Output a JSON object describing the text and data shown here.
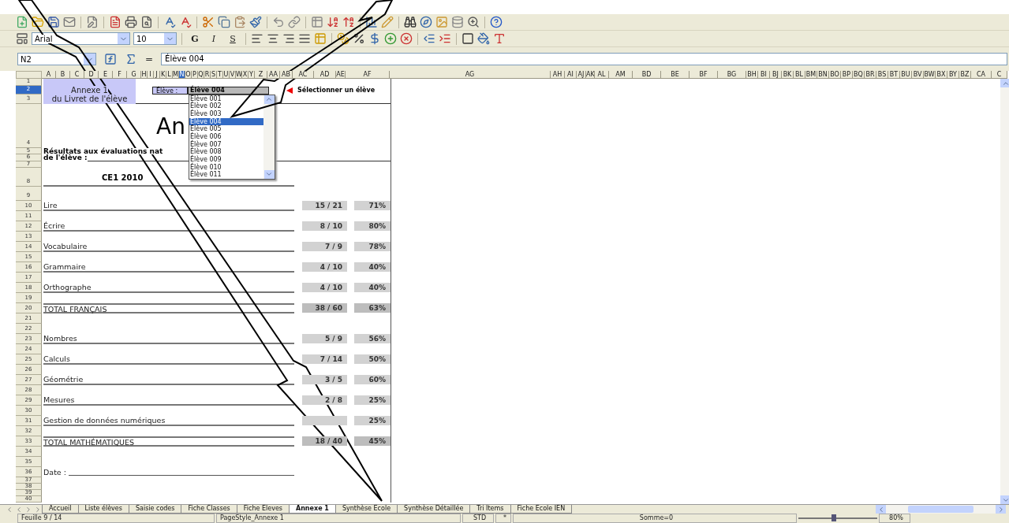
{
  "toolbar": {
    "font_name": "Arial",
    "font_size": "10",
    "format_buttons": [
      {
        "label": "G",
        "selected": false
      },
      {
        "label": "I",
        "selected": false
      },
      {
        "label": "S",
        "selected": false
      }
    ]
  },
  "formula_bar": {
    "cell_ref": "N2",
    "equals": "=",
    "content": "Élève 004"
  },
  "columns": [
    {
      "label": "A",
      "selected": false
    },
    {
      "label": "B",
      "selected": false
    },
    {
      "label": "C",
      "selected": false
    },
    {
      "label": "D",
      "selected": false
    },
    {
      "label": "E",
      "selected": false
    },
    {
      "label": "F",
      "selected": false
    },
    {
      "label": "G",
      "selected": false
    },
    {
      "label": "H",
      "selected": false
    },
    {
      "label": "I",
      "selected": false
    },
    {
      "label": "J",
      "selected": false
    },
    {
      "label": "K",
      "selected": false
    },
    {
      "label": "L",
      "selected": false
    },
    {
      "label": "M",
      "selected": false
    },
    {
      "label": "N",
      "selected": true
    },
    {
      "label": "O",
      "selected": false
    },
    {
      "label": "P",
      "selected": false
    },
    {
      "label": "Q",
      "selected": false
    },
    {
      "label": "R",
      "selected": false
    },
    {
      "label": "S",
      "selected": false
    },
    {
      "label": "T",
      "selected": false
    },
    {
      "label": "U",
      "selected": false
    },
    {
      "label": "V",
      "selected": false
    },
    {
      "label": "W",
      "selected": false
    },
    {
      "label": "X",
      "selected": false
    },
    {
      "label": "Y",
      "selected": false
    },
    {
      "label": "Z",
      "selected": false
    },
    {
      "label": "AA",
      "selected": false
    },
    {
      "label": "AB",
      "selected": false
    },
    {
      "label": "AC",
      "selected": false
    },
    {
      "label": "AD",
      "selected": false
    },
    {
      "label": "AE",
      "selected": false
    },
    {
      "label": "AF",
      "selected": false
    },
    {
      "label": "AG",
      "selected": false
    },
    {
      "label": "AH",
      "selected": false
    },
    {
      "label": "AI",
      "selected": false
    },
    {
      "label": "AJ",
      "selected": false
    },
    {
      "label": "AK",
      "selected": false
    },
    {
      "label": "AL",
      "selected": false
    },
    {
      "label": "AM",
      "selected": false
    },
    {
      "label": "BD",
      "selected": false
    },
    {
      "label": "BE",
      "selected": false
    },
    {
      "label": "BF",
      "selected": false
    },
    {
      "label": "BG",
      "selected": false
    },
    {
      "label": "BH",
      "selected": false
    },
    {
      "label": "BI",
      "selected": false
    },
    {
      "label": "BJ",
      "selected": false
    },
    {
      "label": "BK",
      "selected": false
    },
    {
      "label": "BL",
      "selected": false
    },
    {
      "label": "BM",
      "selected": false
    },
    {
      "label": "BN",
      "selected": false
    },
    {
      "label": "BO",
      "selected": false
    },
    {
      "label": "BP",
      "selected": false
    },
    {
      "label": "BQ",
      "selected": false
    },
    {
      "label": "BR",
      "selected": false
    },
    {
      "label": "BS",
      "selected": false
    },
    {
      "label": "BT",
      "selected": false
    },
    {
      "label": "BU",
      "selected": false
    },
    {
      "label": "BV",
      "selected": false
    },
    {
      "label": "BW",
      "selected": false
    },
    {
      "label": "BX",
      "selected": false
    },
    {
      "label": "BY",
      "selected": false
    },
    {
      "label": "BZ",
      "selected": false
    },
    {
      "label": "CA",
      "selected": false
    },
    {
      "label": "C",
      "selected": false
    }
  ],
  "sheet": {
    "header_block": [
      "Annexe 1",
      "du Livret de l'élève"
    ],
    "picker": {
      "label": "Élève :",
      "value": "Élève 004",
      "expanded": true,
      "options": [
        {
          "label": "Élève 001",
          "selected": false
        },
        {
          "label": "Élève 002",
          "selected": false
        },
        {
          "label": "Élève 003",
          "selected": false
        },
        {
          "label": "Élève 004",
          "selected": true
        },
        {
          "label": "Élève 005",
          "selected": false
        },
        {
          "label": "Élève 006",
          "selected": false
        },
        {
          "label": "Élève 007",
          "selected": false
        },
        {
          "label": "Élève 008",
          "selected": false
        },
        {
          "label": "Élève 009",
          "selected": false
        },
        {
          "label": "Élève 010",
          "selected": false
        },
        {
          "label": "Élève 011",
          "selected": false
        }
      ]
    },
    "hint": "Sélectionner un élève",
    "rows": [
      {
        "number": "1",
        "selected": false
      },
      {
        "number": "2",
        "selected": true
      },
      {
        "number": "3",
        "selected": false
      },
      {
        "number": "4",
        "selected": false,
        "kind": "title",
        "label": "An"
      },
      {
        "number": "5",
        "selected": false,
        "kind": "heading",
        "label": "Résultats aux évaluations nat"
      },
      {
        "number": "6",
        "selected": false,
        "kind": "heading",
        "label": "de l'élève :"
      },
      {
        "number": "7",
        "selected": false
      },
      {
        "number": "8",
        "selected": false,
        "kind": "section",
        "label": "CE1 2010"
      },
      {
        "number": "9",
        "selected": false
      },
      {
        "number": "10",
        "selected": false,
        "kind": "subject",
        "label": "Lire",
        "score": "15 / 21",
        "percent": "71%"
      },
      {
        "number": "11",
        "selected": false
      },
      {
        "number": "12",
        "selected": false,
        "kind": "subject",
        "label": "Écrire",
        "score": "8 / 10",
        "percent": "80%"
      },
      {
        "number": "13",
        "selected": false
      },
      {
        "number": "14",
        "selected": false,
        "kind": "subject",
        "label": "Vocabulaire",
        "score": "7 / 9",
        "percent": "78%"
      },
      {
        "number": "15",
        "selected": false
      },
      {
        "number": "16",
        "selected": false,
        "kind": "subject",
        "label": "Grammaire",
        "score": "4 / 10",
        "percent": "40%"
      },
      {
        "number": "17",
        "selected": false
      },
      {
        "number": "18",
        "selected": false,
        "kind": "subject",
        "label": "Orthographe",
        "score": "4 / 10",
        "percent": "40%"
      },
      {
        "number": "19",
        "selected": false
      },
      {
        "number": "20",
        "selected": false,
        "kind": "total",
        "label": "TOTAL FRANÇAIS",
        "score": "38 / 60",
        "percent": "63%"
      },
      {
        "number": "21",
        "selected": false
      },
      {
        "number": "22",
        "selected": false
      },
      {
        "number": "23",
        "selected": false,
        "kind": "subject",
        "label": "Nombres",
        "score": "5 / 9",
        "percent": "56%"
      },
      {
        "number": "24",
        "selected": false
      },
      {
        "number": "25",
        "selected": false,
        "kind": "subject",
        "label": "Calculs",
        "score": "7 / 14",
        "percent": "50%"
      },
      {
        "number": "26",
        "selected": false
      },
      {
        "number": "27",
        "selected": false,
        "kind": "subject",
        "label": "Géométrie",
        "score": "3 / 5",
        "percent": "60%"
      },
      {
        "number": "28",
        "selected": false
      },
      {
        "number": "29",
        "selected": false,
        "kind": "subject",
        "label": "Mesures",
        "score": "2 / 8",
        "percent": "25%"
      },
      {
        "number": "30",
        "selected": false
      },
      {
        "number": "31",
        "selected": false,
        "kind": "subject",
        "label": "Gestion de données numériques",
        "percent": "25%"
      },
      {
        "number": "32",
        "selected": false
      },
      {
        "number": "33",
        "selected": false,
        "kind": "total",
        "label": "TOTAL MATHÉMATIQUES",
        "score": "18 / 40",
        "percent": "45%"
      },
      {
        "number": "34",
        "selected": false
      },
      {
        "number": "35",
        "selected": false
      },
      {
        "number": "36",
        "selected": false,
        "kind": "date",
        "label": "Date :"
      },
      {
        "number": "37",
        "selected": false
      },
      {
        "number": "38",
        "selected": false
      },
      {
        "number": "39",
        "selected": false
      },
      {
        "number": "40",
        "selected": false
      }
    ]
  },
  "sheet_tabs": [
    {
      "label": "Accueil",
      "selected": false
    },
    {
      "label": "Liste élèves",
      "selected": false
    },
    {
      "label": "Saisie codes",
      "selected": false
    },
    {
      "label": "Fiche Classes",
      "selected": false
    },
    {
      "label": "Fiche Eleves",
      "selected": false
    },
    {
      "label": "Annexe 1",
      "selected": true
    },
    {
      "label": "Synthèse Ecole",
      "selected": false
    },
    {
      "label": "Synthèse Détaillée",
      "selected": false
    },
    {
      "label": "Tri Items",
      "selected": false
    },
    {
      "label": "Fiche Ecole IEN",
      "selected": false
    }
  ],
  "status_bar": {
    "sheet": "Feuille 9 / 14",
    "page_style": "PageStyle_Annexe 1",
    "mode": "STD",
    "modified": "*",
    "sum": "Somme=0",
    "zoom_slider": {
      "level": 0.45
    },
    "zoom": "80%"
  }
}
